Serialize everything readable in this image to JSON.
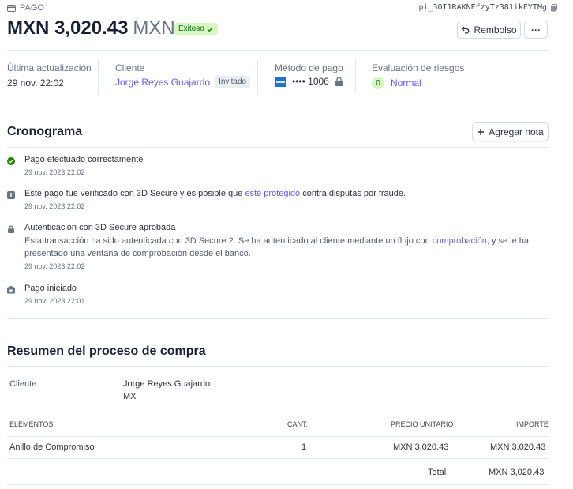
{
  "header": {
    "section_label": "PAGO",
    "payment_id": "pi_3OI1RAKNEfzyTz381ikEYTMg",
    "amount": "MXN 3,020.43",
    "currency": "MXN",
    "status": "Exitoso",
    "refund_label": "Rembolso",
    "more_label": "···"
  },
  "meta": {
    "updated_label": "Última actualización",
    "updated_value": "29 nov. 22:02",
    "customer_label": "Cliente",
    "customer_value": "Jorge Reyes Guajardo",
    "customer_badge": "Invitado",
    "method_label": "Método de pago",
    "method_value": "•••• 1006",
    "risk_label": "Evaluación de riesgos",
    "risk_score": "0",
    "risk_value": "Normal"
  },
  "timeline": {
    "title": "Cronograma",
    "add_note_label": "Agregar nota",
    "items": [
      {
        "title": "Pago efectuado correctamente",
        "time": "29 nov. 2023 22:02"
      },
      {
        "title_pre": "Este pago fue verificado con 3D Secure y es posible que ",
        "title_link": "esté protegido",
        "title_post": " contra disputas por fraude.",
        "time": "29 nov. 2023 22:02"
      },
      {
        "title": "Autenticación con 3D Secure aprobada",
        "desc_pre": "Esta transacción ha sido autenticada con 3D Secure 2. Se ha autenticado al cliente mediante un flujo con ",
        "desc_link": "comprobación",
        "desc_post": ", y se le ha presentado una ventana de comprobación desde el banco.",
        "time": "29 nov. 2023 22:02"
      },
      {
        "title": "Pago iniciado",
        "time": "29 nov. 2023 22:01"
      }
    ]
  },
  "checkout": {
    "title": "Resumen del proceso de compra",
    "customer_label": "Cliente",
    "customer_name": "Jorge Reyes Guajardo",
    "customer_country": "MX",
    "columns": {
      "items": "ELEMENTOS",
      "qty": "CANT.",
      "unit_price": "PRECIO UNITARIO",
      "amount": "IMPORTE"
    },
    "rows": [
      {
        "item": "Anillo de Compromiso",
        "qty": "1",
        "unit_price": "MXN 3,020.43",
        "amount": "MXN 3,020.43"
      }
    ],
    "total_label": "Total",
    "total_value": "MXN 3,020.43"
  },
  "colors": {
    "accent": "#625afa",
    "success": "#05690d",
    "success_bg": "#d7f7c2"
  },
  "icons": {
    "payment": "card-icon",
    "copy": "copy-icon",
    "check": "check-icon",
    "refund": "undo-arrow-icon",
    "lock": "lock-icon",
    "info": "info-icon",
    "plus": "plus-icon",
    "card_brand": "amex-card-icon"
  }
}
